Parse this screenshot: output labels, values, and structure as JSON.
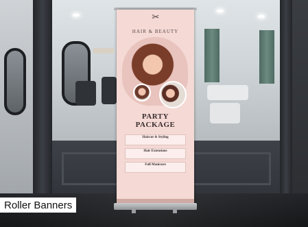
{
  "caption": {
    "label": "Roller Banners"
  },
  "banner": {
    "icon": "scissors-icon",
    "brand": "HAIR & BEAUTY",
    "headline_line1": "PARTY",
    "headline_line2": "PACKAGE",
    "services": [
      {
        "name": "Haircut & Styling"
      },
      {
        "name": "Hair Extensions"
      },
      {
        "name": "Full Manicure"
      }
    ]
  }
}
